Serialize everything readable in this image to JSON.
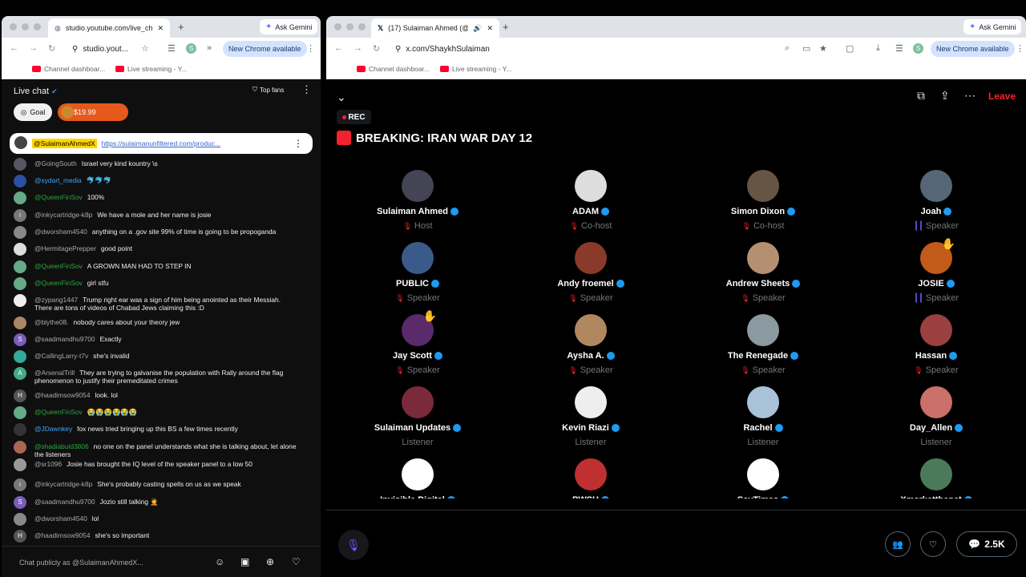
{
  "left": {
    "tab_title": "studio.youtube.com/live_cha",
    "url": "studio.yout...",
    "ask": "Ask Gemini",
    "new_chrome": "New Chrome available",
    "bm1": "Channel dashboar...",
    "bm2": "Live streaming - Y...",
    "chat_title": "Live chat",
    "top_fans": "Top fans",
    "goal": "Goal",
    "supers": "$19.99",
    "pinned_author": "@SulaimanAhmedX",
    "pinned_link": "https://sulaimanunfiltered.com/produc...",
    "messages": [
      {
        "author": "@GoingSouth",
        "text": "Israel very kind kountry \\s",
        "cls": "",
        "color": "#556",
        "init": ""
      },
      {
        "author": "@sydart_media",
        "text": "🐬🐬🐬",
        "cls": "blue",
        "color": "#2d4fa0",
        "init": ""
      },
      {
        "author": "@QueenFinSov",
        "text": "100%",
        "cls": "mem",
        "color": "#6a8",
        "init": ""
      },
      {
        "author": "@inkycartridge-k8p",
        "text": "We have a mole and her name is josie",
        "cls": "",
        "color": "#777",
        "init": "i"
      },
      {
        "author": "@dworsham4540",
        "text": "anything on a .gov site 99% of time is going to be propoganda",
        "cls": "",
        "color": "#888",
        "init": ""
      },
      {
        "author": "@HermitagePrepper",
        "text": "good point",
        "cls": "",
        "color": "#ddd",
        "init": ""
      },
      {
        "author": "@QueenFinSov",
        "text": "A GROWN MAN HAD TO STEP IN",
        "cls": "mem",
        "color": "#6a8",
        "init": ""
      },
      {
        "author": "@QueenFinSov",
        "text": "girl stfu",
        "cls": "mem",
        "color": "#6a8",
        "init": ""
      },
      {
        "author": "@zypang1447",
        "text": "Trump right ear was a sign of him being anointed as their Messiah. There are tons of videos of Chabad Jews claiming this :D",
        "cls": "",
        "color": "#eee",
        "init": ""
      },
      {
        "author": "@blythe08.",
        "text": "nobody cares about your theory jew",
        "cls": "",
        "color": "#a86",
        "init": ""
      },
      {
        "author": "@saadmandhu9700",
        "text": "Exactly",
        "cls": "",
        "color": "#7b5cb8",
        "init": "S"
      },
      {
        "author": "@CallingLarry-t7v",
        "text": "she's invalid",
        "cls": "",
        "color": "#3a9",
        "init": ""
      },
      {
        "author": "@ArsenalTrill",
        "text": "They are trying to galvanise the population with Rally around the flag phenomenon to justify their premeditated crimes",
        "cls": "",
        "color": "#4a8",
        "init": "A"
      },
      {
        "author": "@haadimsow9054",
        "text": "look. lol",
        "cls": "",
        "color": "#555",
        "init": "H"
      },
      {
        "author": "@QueenFinSov",
        "text": "😭😭😭😭😭😭",
        "cls": "mem",
        "color": "#6a8",
        "init": ""
      },
      {
        "author": "@JDawnkey",
        "text": "fox news tried bringing up this BS a few times recently",
        "cls": "blue",
        "color": "#333",
        "init": ""
      },
      {
        "author": "@shadiabuid3806",
        "text": "no one on the panel understands what she is talking about, let alone the listeners",
        "cls": "mem",
        "color": "#a65",
        "init": ""
      },
      {
        "author": "@sr1096",
        "text": "Josie has brought the IQ level of the speaker panel to a low 50",
        "cls": "",
        "color": "#999",
        "init": ""
      },
      {
        "author": "@inkycartridge-k8p",
        "text": "She's probably casting spells on us as we speak",
        "cls": "",
        "color": "#777",
        "init": "i"
      },
      {
        "author": "@saadmandhu9700",
        "text": "Jozio still talking 🤦",
        "cls": "",
        "color": "#7b5cb8",
        "init": "S"
      },
      {
        "author": "@dworsham4540",
        "text": "lol",
        "cls": "",
        "color": "#888",
        "init": ""
      },
      {
        "author": "@haadimsow9054",
        "text": "she's so important",
        "cls": "",
        "color": "#555",
        "init": "H"
      }
    ],
    "chat_placeholder": "Chat publicly as @SulaimanAhmedX..."
  },
  "right": {
    "tab_title": "(17) Sulaiman Ahmed (@S",
    "url": "x.com/ShaykhSulaiman",
    "ask": "Ask Gemini",
    "new_chrome": "New Chrome available",
    "bm1": "Channel dashboar...",
    "bm2": "Live streaming - Y...",
    "leave": "Leave",
    "rec": "REC",
    "title": "BREAKING: IRAN WAR DAY 12",
    "count": "2.5K",
    "participants": [
      {
        "name": "Sulaiman Ahmed",
        "role": "Host",
        "icon": "mic",
        "color": "#445"
      },
      {
        "name": "ADAM",
        "role": "Co-host",
        "icon": "mic",
        "color": "#ddd"
      },
      {
        "name": "Simon Dixon",
        "role": "Co-host",
        "icon": "mic",
        "color": "#665544"
      },
      {
        "name": "Joah",
        "role": "Speaker",
        "icon": "bar",
        "color": "#556677"
      },
      {
        "name": "PUBLIC",
        "role": "Speaker",
        "icon": "mic",
        "color": "#3a5a8a"
      },
      {
        "name": "Andy froemel",
        "role": "Speaker",
        "icon": "mic",
        "color": "#8a3a2a"
      },
      {
        "name": "Andrew Sheets",
        "role": "Speaker",
        "icon": "mic",
        "color": "#b59070"
      },
      {
        "name": "JOSIE",
        "role": "Speaker",
        "icon": "bar",
        "color": "#c25a1a"
      },
      {
        "name": "Jay Scott",
        "role": "Speaker",
        "icon": "mic",
        "color": "#5a2a6a"
      },
      {
        "name": "Aysha A.",
        "role": "Speaker",
        "icon": "mic",
        "color": "#b08860"
      },
      {
        "name": "The Renegade",
        "role": "Speaker",
        "icon": "mic",
        "color": "#8a9aa0"
      },
      {
        "name": "Hassan",
        "role": "Speaker",
        "icon": "mic",
        "color": "#9a4040"
      },
      {
        "name": "Sulaiman Updates",
        "role": "Listener",
        "icon": "",
        "color": "#7a2a3a"
      },
      {
        "name": "Kevin Riazi",
        "role": "Listener",
        "icon": "",
        "color": "#eee"
      },
      {
        "name": "Rachel",
        "role": "Listener",
        "icon": "",
        "color": "#a9c2d8"
      },
      {
        "name": "Day_Allen",
        "role": "Listener",
        "icon": "",
        "color": "#c9706a"
      },
      {
        "name": "Invisible Digital",
        "role": "",
        "icon": "",
        "color": "#fff"
      },
      {
        "name": "PWSH",
        "role": "",
        "icon": "",
        "color": "#c03030"
      },
      {
        "name": "SayTimes",
        "role": "",
        "icon": "",
        "color": "#fff"
      },
      {
        "name": "Xmarketthenet",
        "role": "",
        "icon": "",
        "color": "#4a7a5a"
      }
    ]
  },
  "colors": {
    "x_red": "#f4212e",
    "verified": "#1d9bf0",
    "member_green": "#2ba640"
  }
}
